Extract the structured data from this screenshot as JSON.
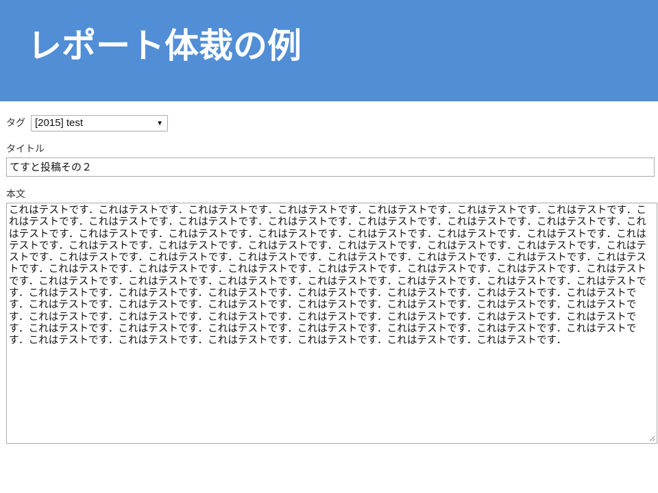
{
  "header": {
    "title": "レポート体裁の例",
    "background_color": "#518ed6"
  },
  "form": {
    "tag": {
      "label": "タグ",
      "selected": "[2015] test"
    },
    "title": {
      "label": "タイトル",
      "value": "てすと投稿その２"
    },
    "body": {
      "label": "本文",
      "value": "これはテストです．これはテストです．これはテストです．これはテストです．これはテストです．これはテストです．これはテストです．これはテストです．これはテストです．これはテストです．これはテストです．これはテストです．これはテストです．これはテストです．これはテストです．これはテストです．これはテストです．これはテストです．これはテストです．これはテストです．これはテストです．これはテストです．これはテストです．これはテストです．これはテストです．これはテストです．これはテストです．これはテストです．これはテストです．これはテストです．これはテストです．これはテストです．これはテストです．これはテストです．これはテストです．これはテストです．これはテストです．これはテストです．これはテストです．これはテストです．これはテストです．これはテストです．これはテストです．これはテストです．これはテストです．これはテストです．これはテストです．これはテストです．これはテストです．これはテストです．これはテストです．これはテストです．これはテストです．これはテストです．これはテストです．これはテストです．これはテストです．これはテストです．これはテストです．これはテストです．これはテストです．これはテストです．これはテストです．これはテストです．これはテストです．これはテストです．これはテストです．これはテストです．これはテストです．これはテストです．これはテストです．これはテストです．これはテストです．これはテストです．これはテストです．これはテストです．これはテストです．これはテストです．これはテストです．これはテストです．これはテストです．これはテストです．これはテストです．これはテストです．"
    }
  }
}
